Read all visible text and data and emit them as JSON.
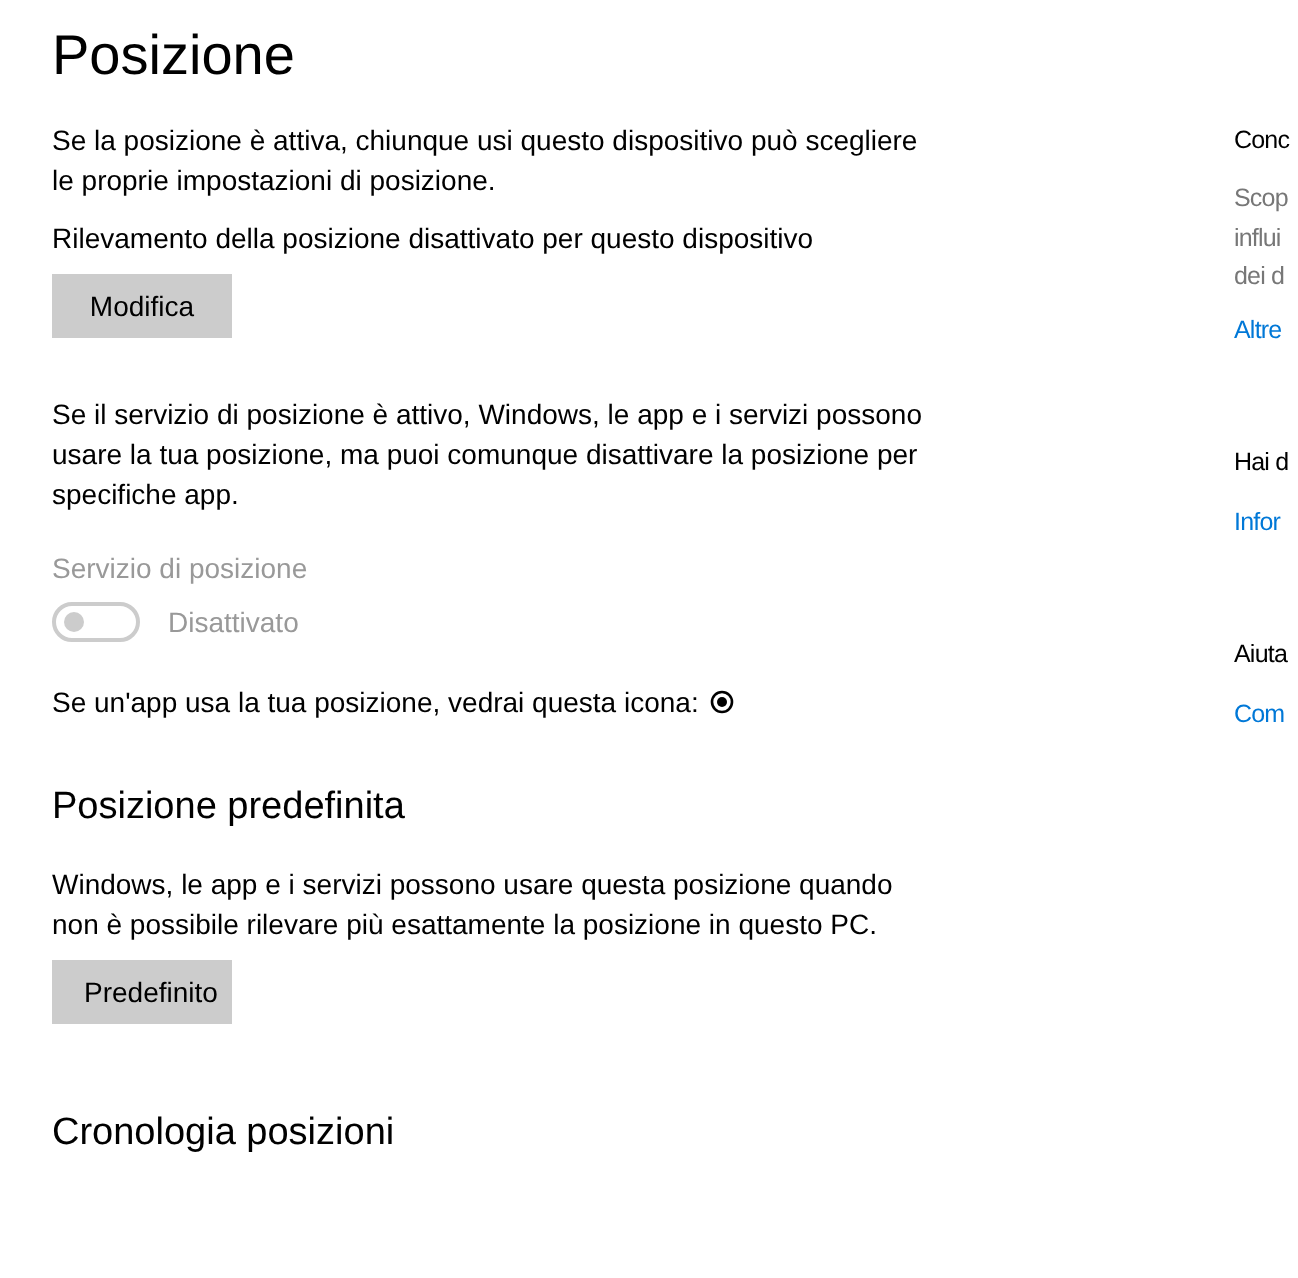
{
  "title": "Posizione",
  "sections": [
    {
      "kind": "para",
      "text": "Se la posizione è attiva, chiunque usi questo dispositivo può scegliere le proprie impostazioni di posizione."
    },
    {
      "kind": "para",
      "text": "Rilevamento della posizione disattivato per questo dispositivo"
    },
    {
      "kind": "button",
      "label": "Modifica"
    },
    {
      "kind": "para",
      "text": "Se il servizio di posizione è attivo, Windows, le app e i servizi possono usare la tua posizione, ma puoi comunque disattivare la posizione per specifiche app."
    },
    {
      "kind": "toggle",
      "label": "Servizio di posizione",
      "state": "Disattivato",
      "on": false,
      "disabled": true
    },
    {
      "kind": "icon-note",
      "text": "Se un'app usa la tua posizione, vedrai questa icona:"
    },
    {
      "kind": "heading",
      "text": "Posizione predefinita"
    },
    {
      "kind": "para",
      "text": "Windows, le app e i servizi possono usare questa posizione quando non è possibile rilevare più esattamente la posizione in questo PC."
    },
    {
      "kind": "button",
      "label": "Predefinito"
    },
    {
      "kind": "heading",
      "text": "Cronologia posizioni"
    }
  ],
  "side": [
    {
      "kind": "heading",
      "text": "Conc"
    },
    {
      "kind": "para",
      "lines": [
        "Scop",
        "influi",
        "dei d"
      ]
    },
    {
      "kind": "link",
      "text": "Altre"
    },
    {
      "kind": "heading",
      "text": "Hai d"
    },
    {
      "kind": "link",
      "text": "Infor"
    },
    {
      "kind": "heading",
      "text": "Aiuta"
    },
    {
      "kind": "link",
      "text": "Com"
    }
  ]
}
